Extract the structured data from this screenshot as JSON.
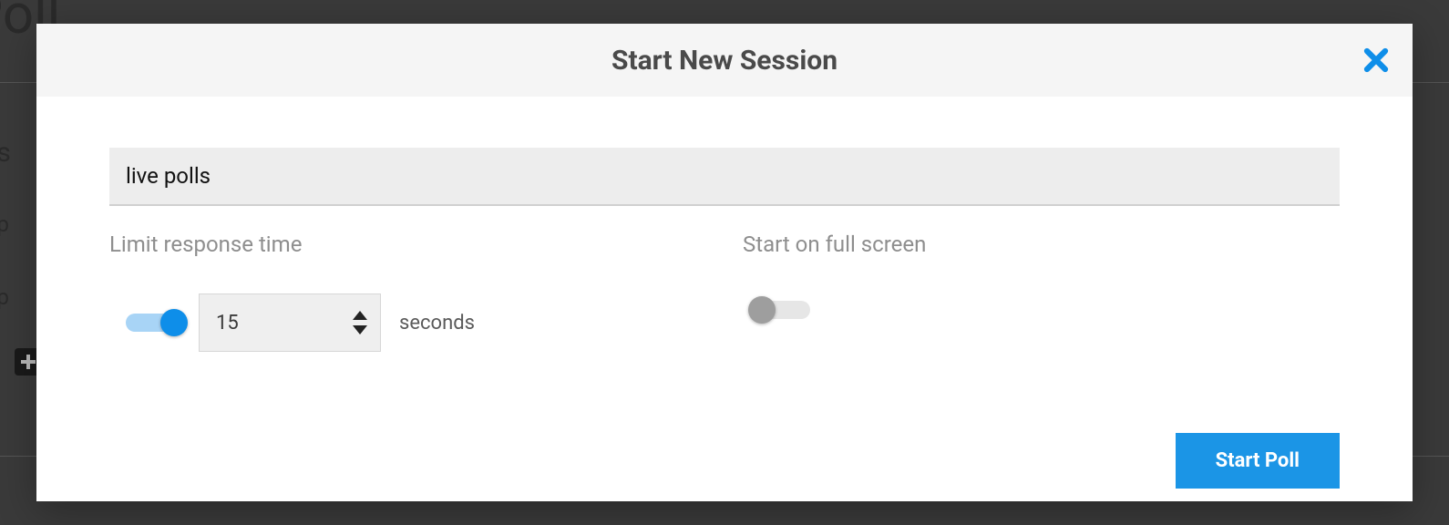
{
  "background": {
    "page_title": "ve Poll",
    "as_label": "as",
    "option1_label": "Op",
    "option2_label": "Op"
  },
  "modal": {
    "title": "Start New Session",
    "session_name": "live polls",
    "options": {
      "limit_response": {
        "label": "Limit response time",
        "enabled": true,
        "seconds_value": "15",
        "seconds_unit": "seconds"
      },
      "fullscreen": {
        "label": "Start on full screen",
        "enabled": false
      }
    },
    "start_button": "Start Poll"
  }
}
